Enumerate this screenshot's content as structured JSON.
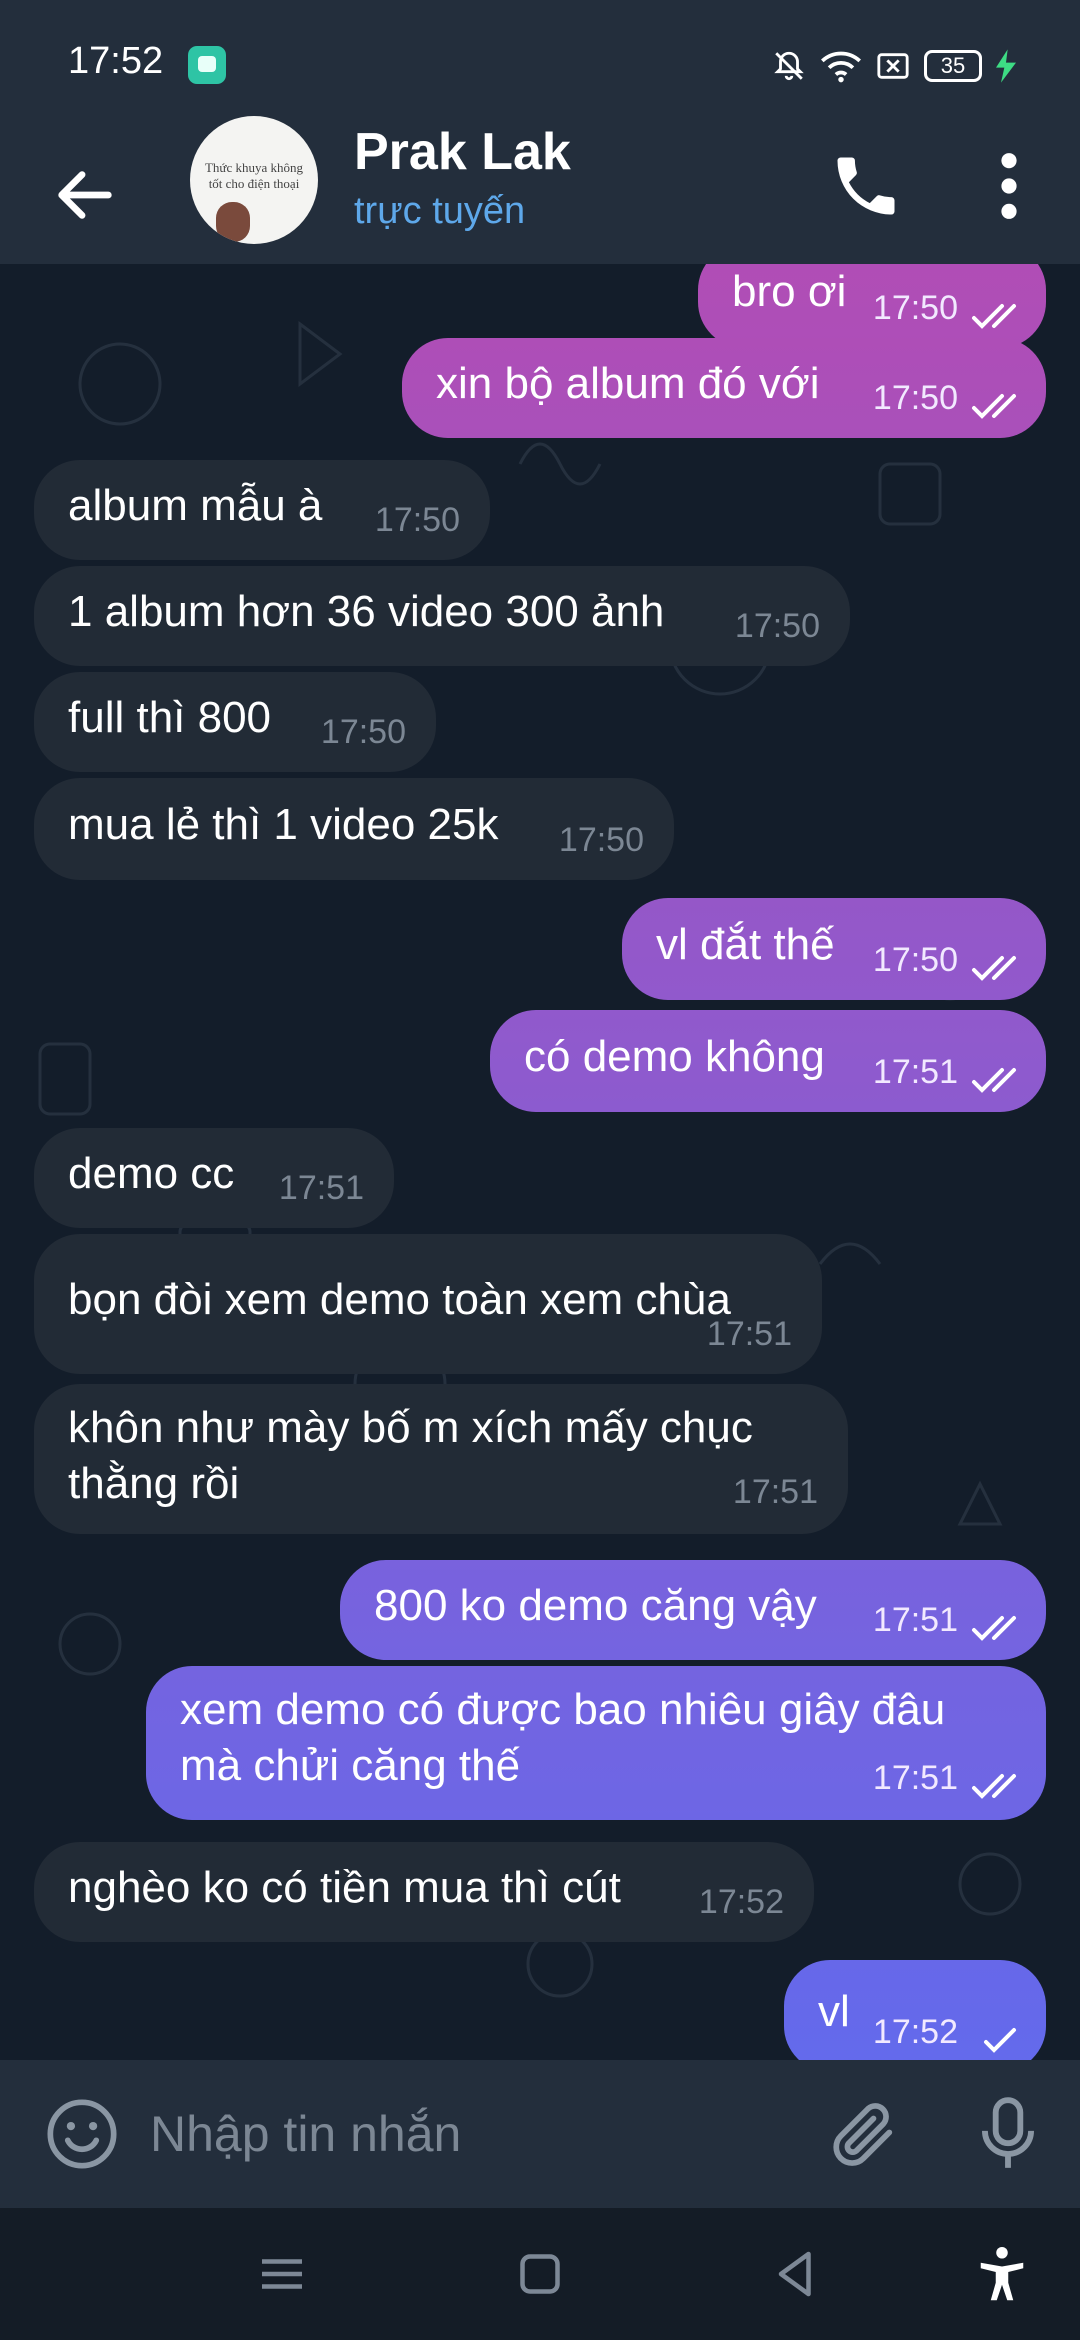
{
  "status_bar": {
    "time": "17:52",
    "battery": "35"
  },
  "header": {
    "contact_name": "Prak Lak",
    "contact_status": "trực tuyến",
    "avatar_caption": "Thức khuya không tốt cho điện thoại"
  },
  "colors": {
    "header_bg": "#232e3c",
    "chat_bg": "#131d2a",
    "incoming_bubble": "#222b36",
    "outgoing_gradient_top": "#a44bb0",
    "outgoing_gradient_bottom": "#6a5ee2",
    "online_status": "#5ea8ea"
  },
  "messages": [
    {
      "dir": "out",
      "text": "bro ơi",
      "time": "17:50",
      "status": "read"
    },
    {
      "dir": "out",
      "text": "xin bộ album đó với",
      "time": "17:50",
      "status": "read"
    },
    {
      "dir": "in",
      "text": "album mẫu à",
      "time": "17:50"
    },
    {
      "dir": "in",
      "text": "1 album hơn 36 video 300 ảnh",
      "time": "17:50"
    },
    {
      "dir": "in",
      "text": "full thì 800",
      "time": "17:50"
    },
    {
      "dir": "in",
      "text": "mua lẻ thì 1 video 25k",
      "time": "17:50"
    },
    {
      "dir": "out",
      "text": "vl đắt thế",
      "time": "17:50",
      "status": "read"
    },
    {
      "dir": "out",
      "text": "có demo không",
      "time": "17:51",
      "status": "read"
    },
    {
      "dir": "in",
      "text": "demo cc",
      "time": "17:51"
    },
    {
      "dir": "in",
      "text": "bọn đòi xem demo toàn xem chùa",
      "time": "17:51"
    },
    {
      "dir": "in",
      "text": "khôn như mày bố m xích mấy chục\nthằng rồi",
      "time": "17:51"
    },
    {
      "dir": "out",
      "text": "800 ko demo căng vậy",
      "time": "17:51",
      "status": "read"
    },
    {
      "dir": "out",
      "text": "xem demo có được bao nhiêu giây đâu\nmà chửi căng thế",
      "time": "17:51",
      "status": "read"
    },
    {
      "dir": "in",
      "text": "nghèo ko có tiền mua thì cút",
      "time": "17:52"
    },
    {
      "dir": "out",
      "text": "vl",
      "time": "17:52",
      "status": "sent"
    }
  ],
  "input": {
    "placeholder": "Nhập tin nhắn"
  },
  "icons": {
    "back": "arrow-left",
    "call": "phone",
    "menu": "more-vertical",
    "emoji": "smiley",
    "attach": "paperclip",
    "mic": "microphone"
  }
}
